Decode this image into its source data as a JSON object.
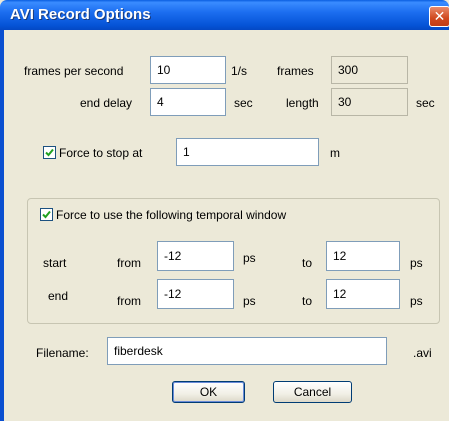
{
  "window": {
    "title": "AVI Record Options",
    "close_glyph": "✕"
  },
  "fps": {
    "label": "frames per second",
    "value": "10",
    "unit": "1/s"
  },
  "frames": {
    "label": "frames",
    "value": "300"
  },
  "end_delay": {
    "label": "end delay",
    "value": "4",
    "unit": "sec"
  },
  "length": {
    "label": "length",
    "value": "30",
    "unit": "sec"
  },
  "force_stop": {
    "label": "Force to stop at",
    "checked": true,
    "value": "1",
    "unit": "m"
  },
  "temporal": {
    "label": "Force to use the following temporal window",
    "checked": true,
    "start": {
      "label": "start",
      "from_label": "from",
      "from": "-12",
      "from_unit": "ps",
      "to_label": "to",
      "to": "12",
      "to_unit": "ps"
    },
    "end": {
      "label": "end",
      "from_label": "from",
      "from": "-12",
      "from_unit": "ps",
      "to_label": "to",
      "to": "12",
      "to_unit": "ps"
    }
  },
  "filename": {
    "label": "Filename:",
    "value": "fiberdesk",
    "ext": ".avi"
  },
  "buttons": {
    "ok": "OK",
    "cancel": "Cancel"
  },
  "colors": {
    "titlebar": "#0553d6",
    "dialog_bg": "#ece9d8",
    "close": "#d0481e",
    "check": "#21a121"
  }
}
